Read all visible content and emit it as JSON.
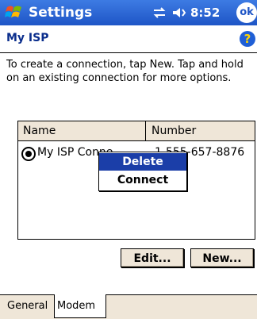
{
  "titlebar": {
    "title": "Settings",
    "time": "8:52",
    "ok_label": "ok"
  },
  "header": {
    "title": "My ISP",
    "help_label": "?"
  },
  "instruction": "To create a connection, tap New. Tap and hold on an existing connection for more options.",
  "list": {
    "columns": [
      "Name",
      "Number"
    ],
    "rows": [
      {
        "name": "My ISP Conne",
        "number": "1-555-657-8876",
        "selected": true
      }
    ]
  },
  "context_menu": {
    "items": [
      "Delete",
      "Connect"
    ],
    "highlighted": "Delete"
  },
  "buttons": {
    "edit": "Edit...",
    "new": "New..."
  },
  "tabs": [
    "General",
    "Modem"
  ],
  "active_tab": "Modem",
  "colors": {
    "titlebar": "#1e55c6",
    "header_text": "#0a2d8c",
    "menu_highlight": "#1b3ea8",
    "chrome": "#efe6d8"
  }
}
